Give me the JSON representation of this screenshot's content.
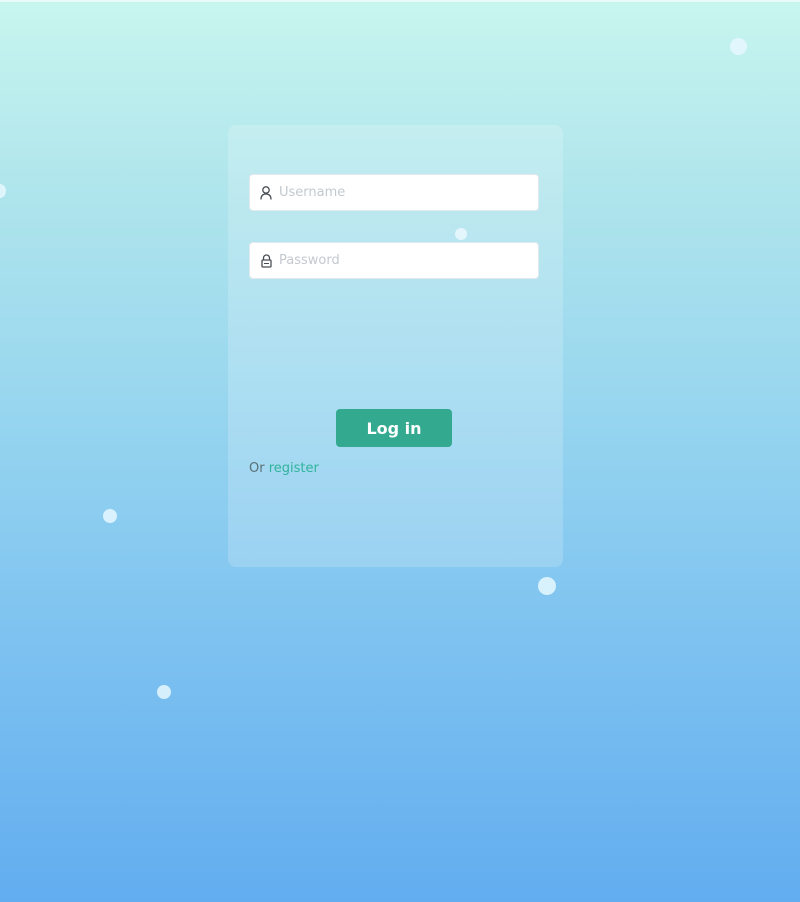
{
  "form": {
    "username_placeholder": "Username",
    "password_placeholder": "Password",
    "username_value": "",
    "password_value": "",
    "login_label": "Log in",
    "register_prefix": "Or",
    "register_link": "register"
  },
  "icons": {
    "username": "user-icon",
    "password": "lock-icon"
  },
  "colors": {
    "primary_button": "#33aa90",
    "link": "#2fb39a",
    "background_top": "#c8f6ef",
    "background_bottom": "#62adf0"
  }
}
